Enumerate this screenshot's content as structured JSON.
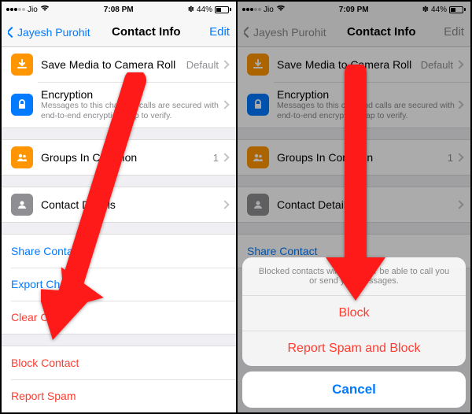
{
  "left": {
    "status": {
      "carrier": "Jio",
      "time": "7:08 PM",
      "battery": "44%"
    },
    "nav": {
      "back": "Jayesh Purohit",
      "title": "Contact Info",
      "edit": "Edit"
    },
    "save_media": {
      "title": "Save Media to Camera Roll",
      "value": "Default"
    },
    "encryption": {
      "title": "Encryption",
      "sub": "Messages to this chat and calls are secured with end-to-end encryption. Tap to verify."
    },
    "groups": {
      "title": "Groups In Common",
      "value": "1"
    },
    "details": {
      "title": "Contact Details"
    },
    "share": "Share Contact",
    "export": "Export Chat",
    "clear": "Clear Chat",
    "block": "Block Contact",
    "report": "Report Spam"
  },
  "right": {
    "status": {
      "carrier": "Jio",
      "time": "7:09 PM",
      "battery": "44%"
    },
    "nav": {
      "back": "Jayesh Purohit",
      "title": "Contact Info",
      "edit": "Edit"
    },
    "save_media": {
      "title": "Save Media to Camera Roll",
      "value": "Default"
    },
    "encryption": {
      "title": "Encryption",
      "sub": "Messages to this chat and calls are secured with end-to-end encryption. Tap to verify."
    },
    "groups": {
      "title": "Groups In Common",
      "value": "1"
    },
    "details": {
      "title": "Contact Details"
    },
    "share": "Share Contact",
    "sheet": {
      "message": "Blocked contacts will no longer be able to call you or send you messages.",
      "block": "Block",
      "report": "Report Spam and Block",
      "cancel": "Cancel"
    }
  },
  "colors": {
    "accent_blue": "#007aff",
    "accent_red": "#ff3b30",
    "arrow": "#ff1a1a"
  }
}
